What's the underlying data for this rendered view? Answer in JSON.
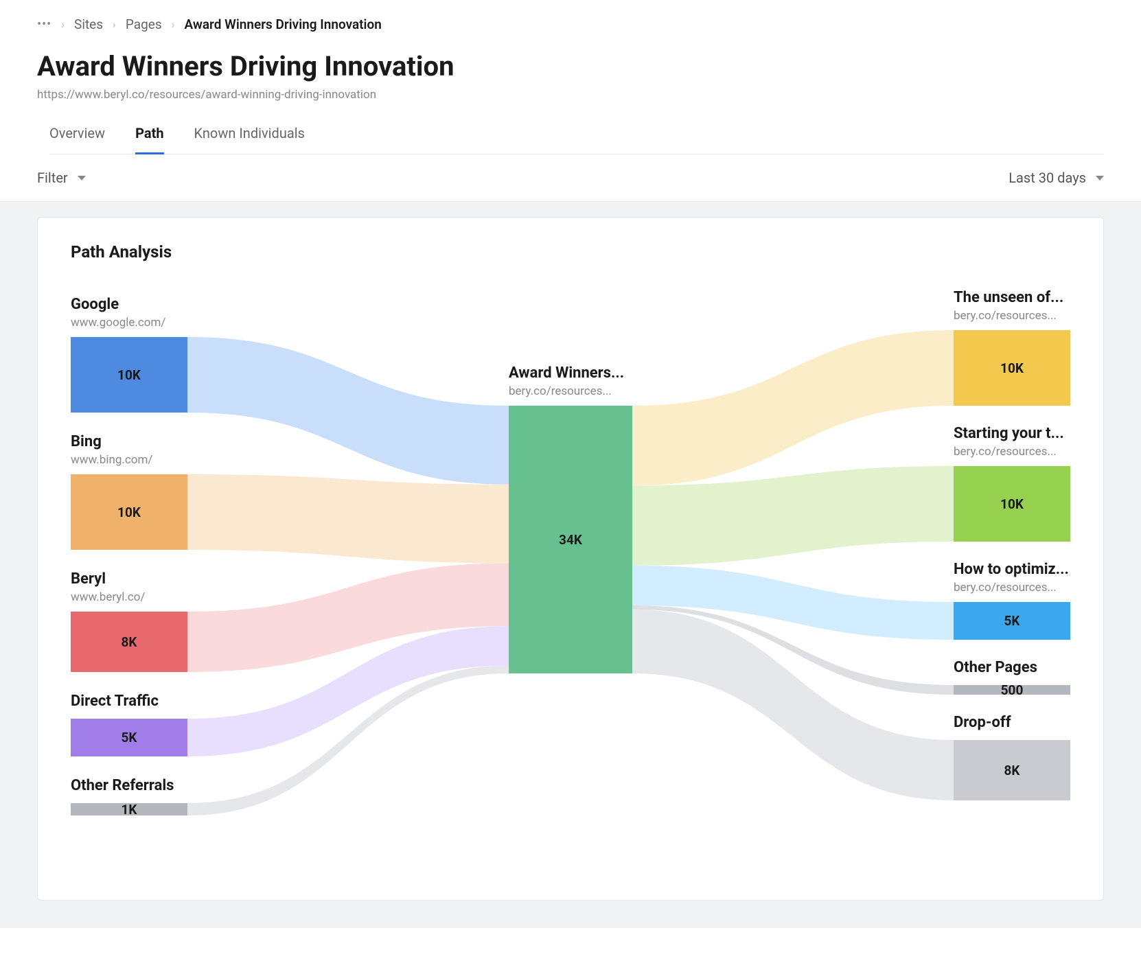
{
  "breadcrumb": {
    "items": [
      "Sites",
      "Pages"
    ],
    "current": "Award Winners Driving Innovation"
  },
  "page": {
    "title": "Award Winners Driving Innovation",
    "url": "https://www.beryl.co/resources/award-winning-driving-innovation"
  },
  "tabs": {
    "items": [
      {
        "label": "Overview",
        "active": false
      },
      {
        "label": "Path",
        "active": true
      },
      {
        "label": "Known Individuals",
        "active": false
      }
    ]
  },
  "filter": {
    "label": "Filter",
    "daterange": "Last 30 days"
  },
  "card": {
    "title": "Path Analysis"
  },
  "chart_data": {
    "type": "sankey",
    "title": "Path Analysis",
    "center": {
      "title": "Award Winners...",
      "subtitle": "bery.co/resources...",
      "value": "34K",
      "color": "#66c08f"
    },
    "sources": [
      {
        "title": "Google",
        "subtitle": "www.google.com/",
        "value": "10K",
        "num": 10000,
        "color": "#4d8ae0",
        "link_color": "#c9defb"
      },
      {
        "title": "Bing",
        "subtitle": "www.bing.com/",
        "value": "10K",
        "num": 10000,
        "color": "#f0b26b",
        "link_color": "#fbe8d1"
      },
      {
        "title": "Beryl",
        "subtitle": "www.beryl.co/",
        "value": "8K",
        "num": 8000,
        "color": "#e8696c",
        "link_color": "#fadadb"
      },
      {
        "title": "Direct Traffic",
        "subtitle": "",
        "value": "5K",
        "num": 5000,
        "color": "#a07de8",
        "link_color": "#e7dffb"
      },
      {
        "title": "Other Referrals",
        "subtitle": "",
        "value": "1K",
        "num": 1000,
        "color": "#b3b7be",
        "link_color": "#e6e7ea"
      }
    ],
    "targets": [
      {
        "title": "The unseen of...",
        "subtitle": "bery.co/resources...",
        "value": "10K",
        "num": 10000,
        "color": "#f2c94c",
        "link_color": "#fbedc7"
      },
      {
        "title": "Starting your t...",
        "subtitle": "bery.co/resources...",
        "value": "10K",
        "num": 10000,
        "color": "#95d04f",
        "link_color": "#e2f2cd"
      },
      {
        "title": "How to optimiz...",
        "subtitle": "bery.co/resources...",
        "value": "5K",
        "num": 5000,
        "color": "#3aa7ef",
        "link_color": "#d2edff"
      },
      {
        "title": "Other Pages",
        "subtitle": "",
        "value": "500",
        "num": 500,
        "color": "#b3b7be",
        "link_color": "#dedfe2"
      },
      {
        "title": "Drop-off",
        "subtitle": "",
        "value": "8K",
        "num": 8000,
        "color": "#c9cbd1",
        "link_color": "#e6e7ea"
      }
    ]
  }
}
